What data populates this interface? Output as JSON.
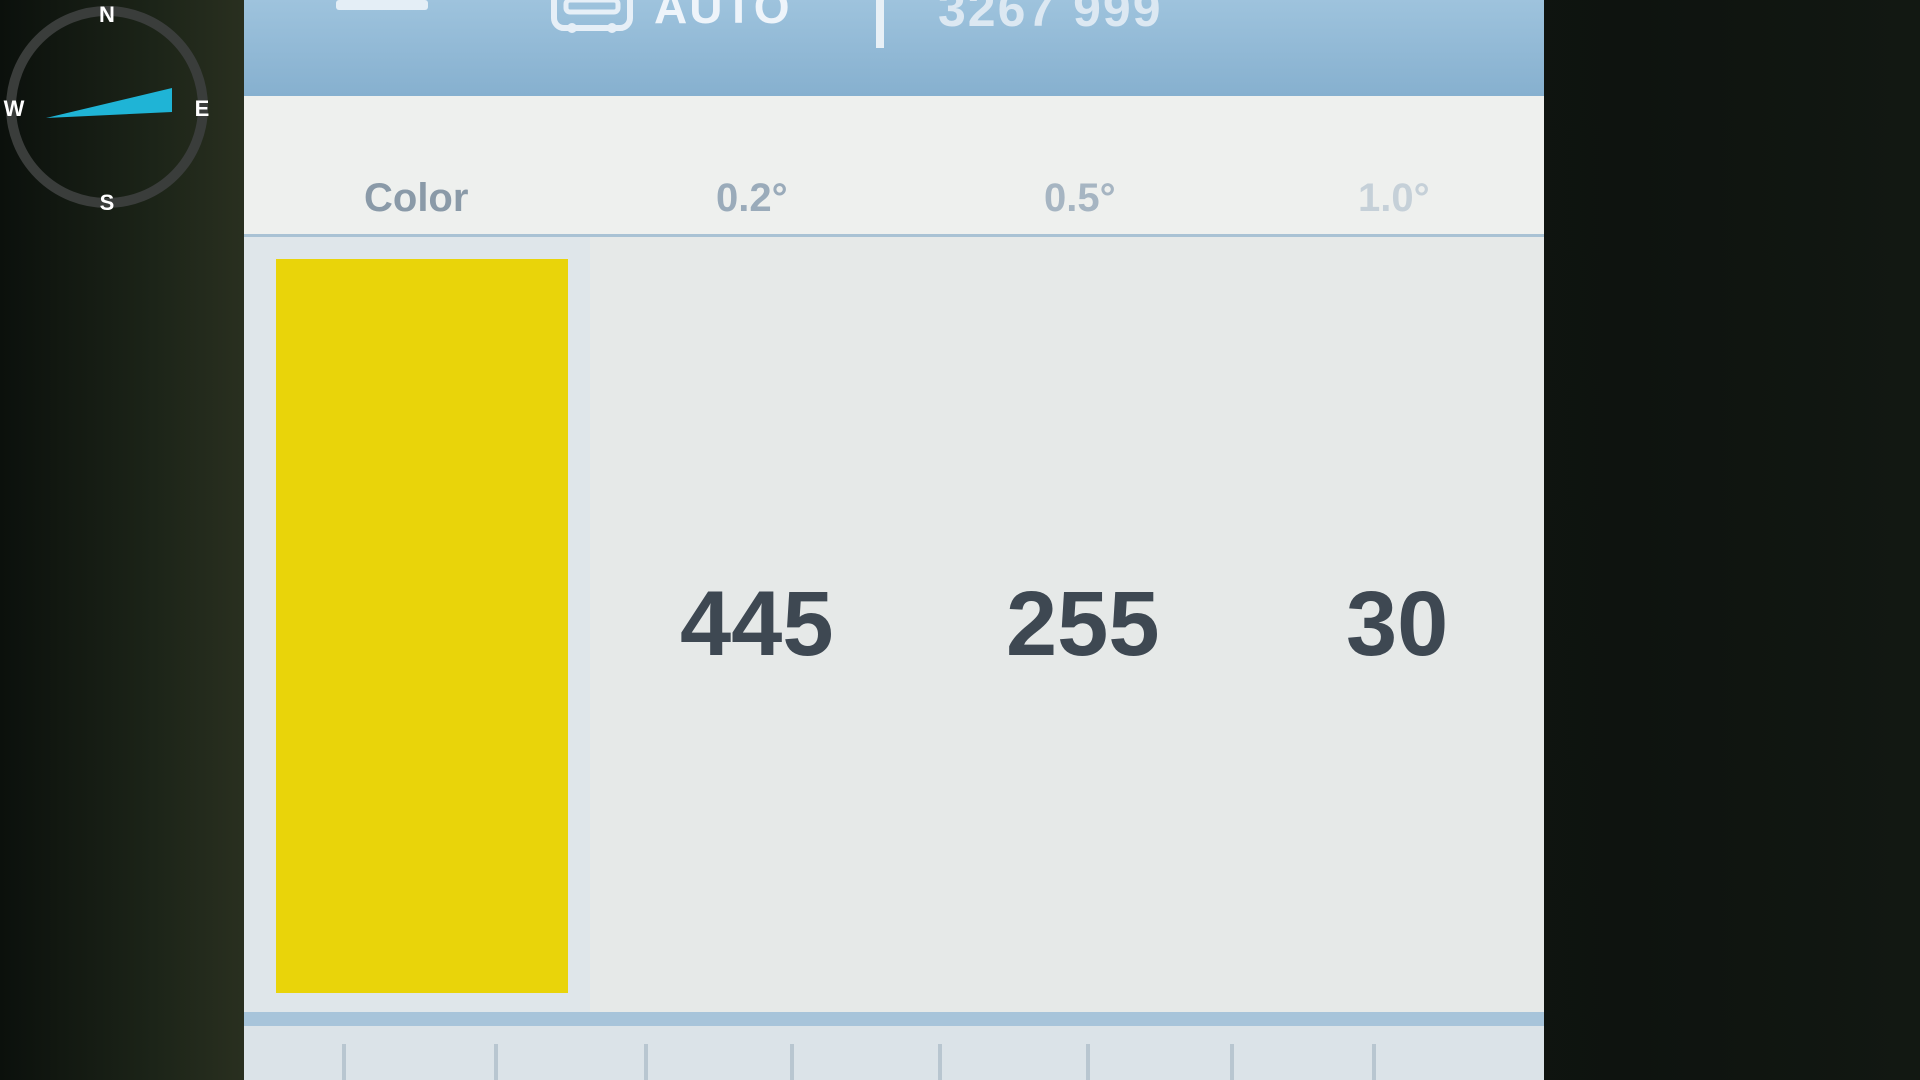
{
  "compass": {
    "north": "N",
    "east": "E",
    "south": "S",
    "west": "W",
    "needle_color": "#1fb4d6"
  },
  "topbar": {
    "tab_label": "AUTO",
    "sample_id": "3267 999"
  },
  "table": {
    "headers": [
      "Color",
      "0.2°",
      "0.5°",
      "1.0°"
    ],
    "swatch_color": "#e9d40a",
    "values": [
      "445",
      "255",
      "30"
    ]
  }
}
